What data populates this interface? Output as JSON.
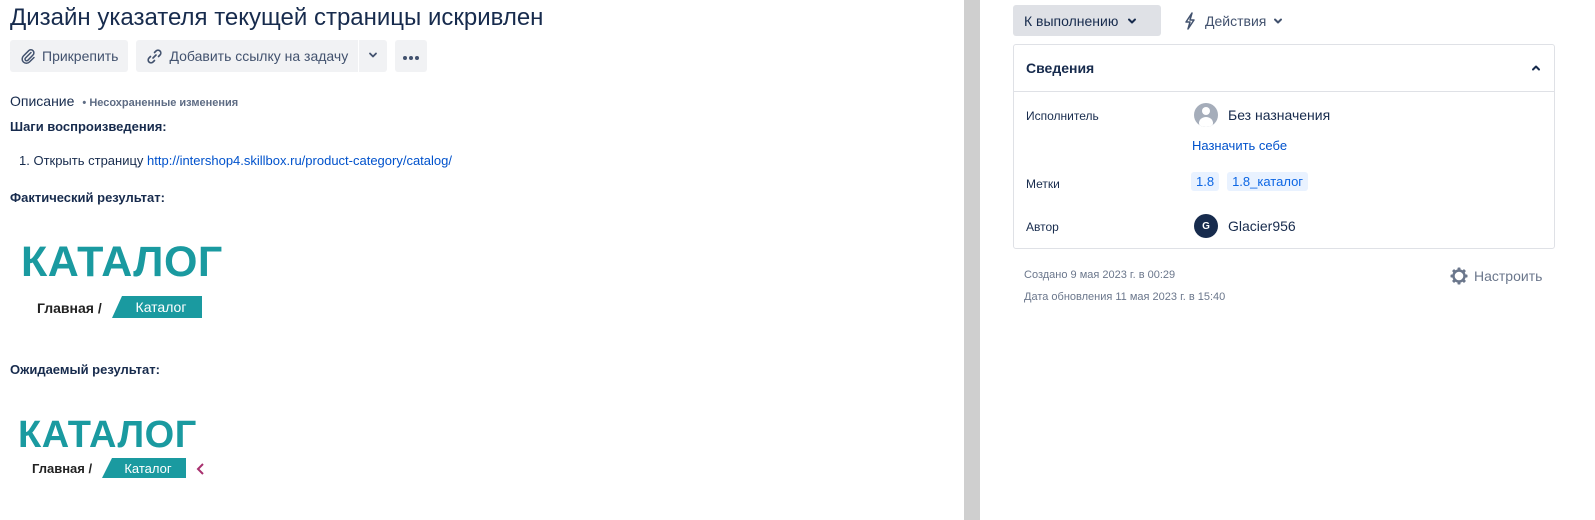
{
  "issue": {
    "title": "Дизайн указателя текущей страницы искривлен"
  },
  "toolbar": {
    "attach_label": "Прикрепить",
    "link_label": "Добавить ссылку на задачу",
    "more_label": "•••"
  },
  "description": {
    "label": "Описание",
    "unsaved": "• Несохраненные изменения",
    "steps_heading": "Шаги воспроизведения:",
    "step1_prefix": "1. Открыть страницу ",
    "step1_link": "http://intershop4.skillbox.ru/product-category/catalog/",
    "actual_heading": "Фактический результат:",
    "expected_heading": "Ожидаемый результат:",
    "actual_image": {
      "title": "КАТАЛОГ",
      "home": "Главная /",
      "current": "Каталог"
    },
    "expected_image": {
      "title": "КАТАЛОГ",
      "home": "Главная /",
      "current": "Каталог"
    }
  },
  "sidebar": {
    "status_label": "К выполнению",
    "actions_label": "Действия",
    "details": {
      "heading": "Сведения",
      "assignee_label": "Исполнитель",
      "assignee_value": "Без назначения",
      "assign_self": "Назначить себе",
      "labels_label": "Метки",
      "labels": [
        "1.8",
        "1.8_каталог"
      ],
      "reporter_label": "Автор",
      "reporter_initial": "G",
      "reporter_name": "Glacier956"
    },
    "created": "Создано 9 мая 2023 г. в 00:29",
    "updated": "Дата обновления 11 мая 2023 г. в 15:40",
    "configure_label": "Настроить"
  },
  "colors": {
    "link": "#0052cc",
    "teal": "#1a9aa0",
    "text": "#172b4d",
    "divider": "#cfcfcf"
  },
  "icons": [
    "paperclip-icon",
    "link-icon",
    "chevron-down-icon",
    "more-icon",
    "lightning-icon",
    "chevron-up-icon",
    "user-icon",
    "gear-icon"
  ]
}
